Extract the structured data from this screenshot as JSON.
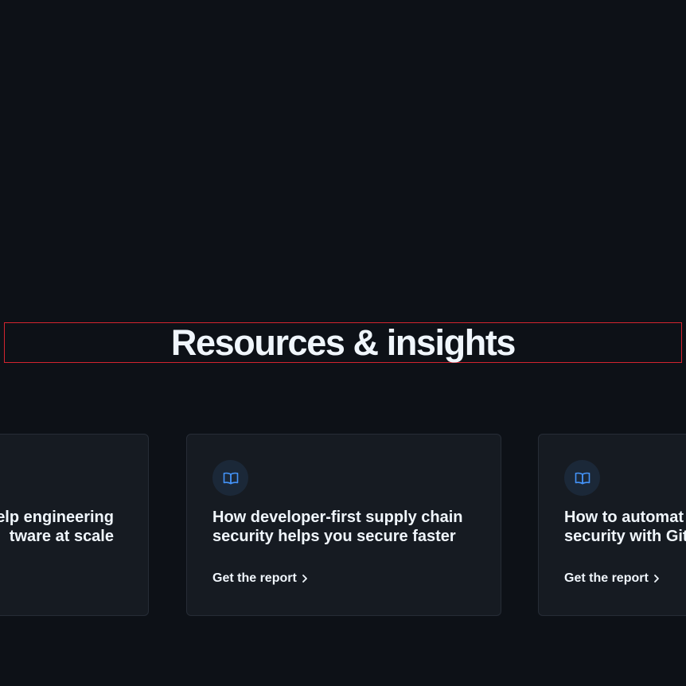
{
  "section": {
    "heading": "Resources & insights"
  },
  "cards": [
    {
      "title_line1": "elp engineering",
      "title_line2": "tware at scale"
    },
    {
      "icon": "book-icon",
      "title_line1": "How developer-first supply chain",
      "title_line2": "security helps you secure faster",
      "link_label": "Get the report"
    },
    {
      "icon": "book-icon",
      "title_line1": "How to automat",
      "title_line2": "security with Git",
      "link_label": "Get the report"
    }
  ],
  "colors": {
    "background": "#0d1117",
    "card": "#161b22",
    "icon_accent": "#4493f8",
    "heading_outline": "#d1242f"
  }
}
